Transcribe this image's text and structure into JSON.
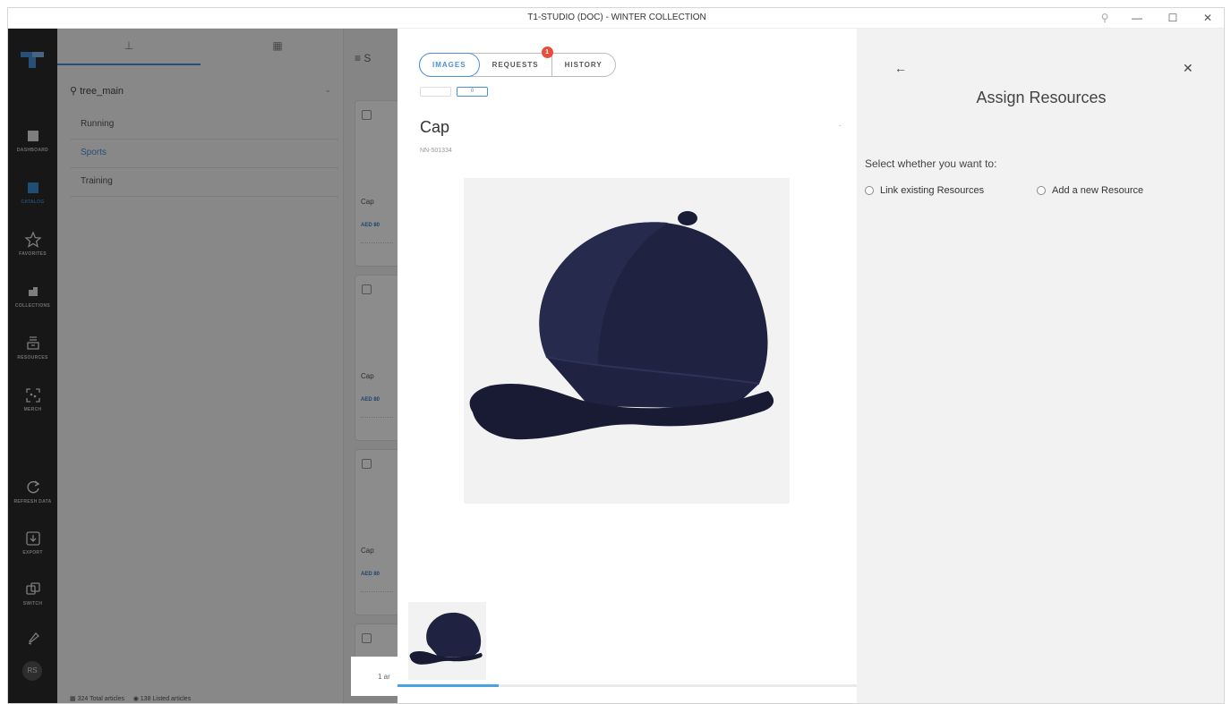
{
  "window": {
    "title": "T1-STUDIO (DOC) - WINTER COLLECTION"
  },
  "rail": {
    "items": [
      {
        "label": "DASHBOARD",
        "icon": "dashboard-icon"
      },
      {
        "label": "CATALOG",
        "icon": "catalog-icon",
        "active": true
      },
      {
        "label": "FAVORITES",
        "icon": "star-icon"
      },
      {
        "label": "COLLECTIONS",
        "icon": "collections-icon"
      },
      {
        "label": "RESOURCES",
        "icon": "resources-icon"
      },
      {
        "label": "MERCH",
        "icon": "merch-icon"
      },
      {
        "label": "REFRESH DATA",
        "icon": "refresh-icon"
      },
      {
        "label": "EXPORT",
        "icon": "export-icon"
      },
      {
        "label": "SWITCH",
        "icon": "switch-icon"
      }
    ],
    "avatar": "RS"
  },
  "tree": {
    "search_value": "tree_main",
    "items": [
      "Running",
      "Sports",
      "Training"
    ]
  },
  "grid": {
    "head": "S",
    "cards": [
      {
        "name": "Cap",
        "price": "AED 80"
      },
      {
        "name": "Cap",
        "price": "AED 80"
      },
      {
        "name": "Cap",
        "price": "AED 80"
      }
    ],
    "page": "1 ar"
  },
  "statusbar": {
    "total": "324 Total articles",
    "listed": "138 Listed articles"
  },
  "detail": {
    "tabs": {
      "images": "IMAGES",
      "requests": "REQUESTS",
      "history": "HISTORY"
    },
    "requests_badge": "1",
    "mini_btn_2": "0",
    "title": "Cap",
    "number": "NN-501334",
    "dash": "-",
    "progress_fraction": 0.22
  },
  "assign": {
    "title": "Assign Resources",
    "prompt": "Select whether you want to:",
    "option_link": "Link existing Resources",
    "option_add": "Add a new Resource"
  },
  "colors": {
    "accent": "#4a90d9",
    "badge": "#e74c3c",
    "rail": "#2a2a2a",
    "cap": "#1c1f3a"
  }
}
